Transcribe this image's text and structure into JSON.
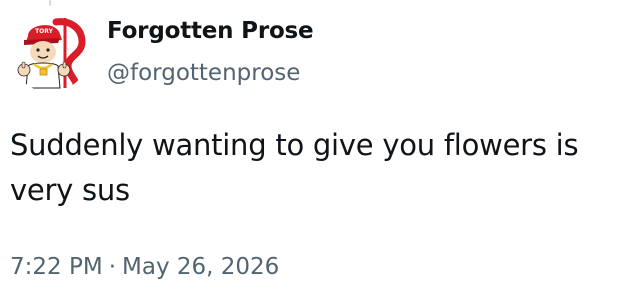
{
  "author": {
    "display_name": "Forgotten Prose",
    "handle": "@forgottenprose",
    "avatar_icon": "cartoon-character-avatar",
    "avatar_cap_text": "TORY"
  },
  "tweet": {
    "text": "Suddenly wanting to give you flowers is very sus"
  },
  "meta": {
    "time": "7:22 PM",
    "separator": "·",
    "date": "May 26, 2026"
  },
  "colors": {
    "text_primary": "#0f1419",
    "text_secondary": "#536471",
    "avatar_red": "#d91e2a",
    "avatar_gold": "#f2c230",
    "thread_line": "#cfd9de"
  }
}
